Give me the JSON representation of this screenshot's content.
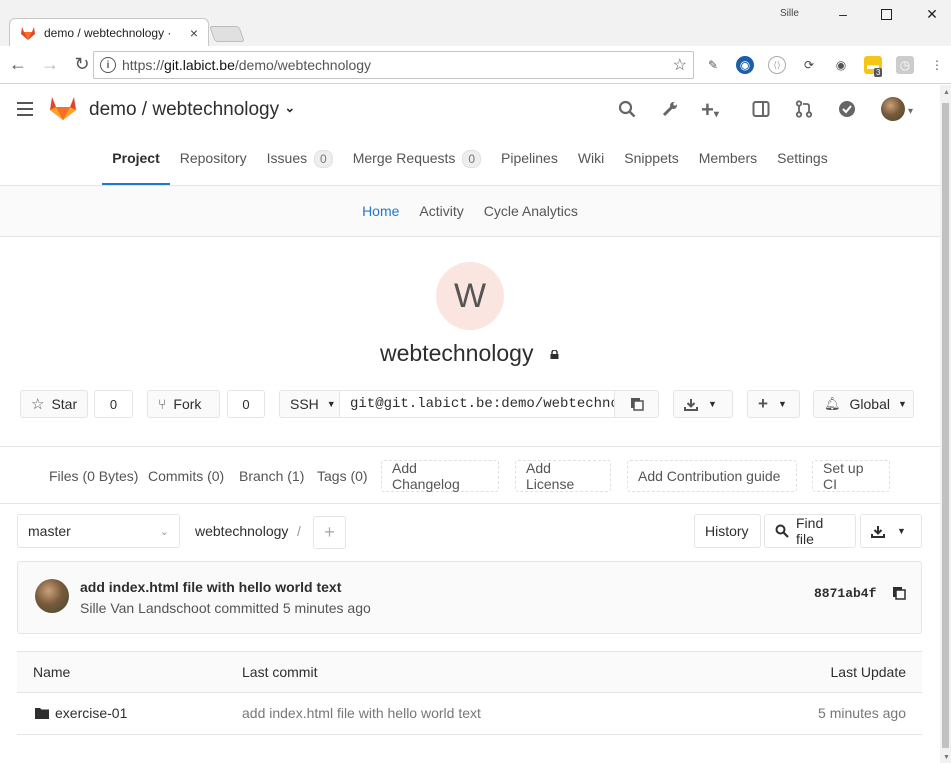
{
  "browser": {
    "tab_title": "demo / webtechnology ·",
    "tab_close": "×",
    "window_user": "Sille",
    "url_proto": "https://",
    "url_host": "git.labict.be",
    "url_path": "/demo/webtechnology",
    "ext_badge": "3"
  },
  "header": {
    "project_path": "demo / webtechnology",
    "chevron": "⌄"
  },
  "project_nav": {
    "items": [
      {
        "label": "Project"
      },
      {
        "label": "Repository"
      },
      {
        "label": "Issues",
        "badge": "0"
      },
      {
        "label": "Merge Requests",
        "badge": "0"
      },
      {
        "label": "Pipelines"
      },
      {
        "label": "Wiki"
      },
      {
        "label": "Snippets"
      },
      {
        "label": "Members"
      },
      {
        "label": "Settings"
      }
    ]
  },
  "sub_nav": {
    "items": [
      {
        "label": "Home"
      },
      {
        "label": "Activity"
      },
      {
        "label": "Cycle Analytics"
      }
    ]
  },
  "project": {
    "avatar_letter": "W",
    "name": "webtechnology"
  },
  "actions": {
    "star_label": "Star",
    "star_count": "0",
    "fork_label": "Fork",
    "fork_count": "0",
    "protocol": "SSH",
    "clone_url": "git@git.labict.be:demo/webtechnology.git",
    "notification_label": "Global"
  },
  "stats": {
    "files": "Files (0 Bytes)",
    "commits": "Commits (0)",
    "branch": "Branch (1)",
    "tags": "Tags (0)",
    "add_changelog": "Add Changelog",
    "add_license": "Add License",
    "add_contribution": "Add Contribution guide",
    "setup_ci": "Set up CI"
  },
  "tree": {
    "branch": "master",
    "path": "webtechnology",
    "path_sep": "/",
    "history": "History",
    "find_file": "Find file"
  },
  "last_commit": {
    "title": "add index.html file with hello world text",
    "author_line": "Sille Van Landschoot committed 5 minutes ago",
    "sha": "8871ab4f"
  },
  "files_table": {
    "headers": {
      "name": "Name",
      "last_commit": "Last commit",
      "last_update": "Last Update"
    },
    "rows": [
      {
        "name": "exercise-01",
        "commit": "add index.html file with hello world text",
        "updated": "5 minutes ago"
      }
    ]
  },
  "colors": {
    "accent": "#1f78d1",
    "avatar_bg": "#fbe5e1",
    "tanuki_orange": "#e24329"
  }
}
